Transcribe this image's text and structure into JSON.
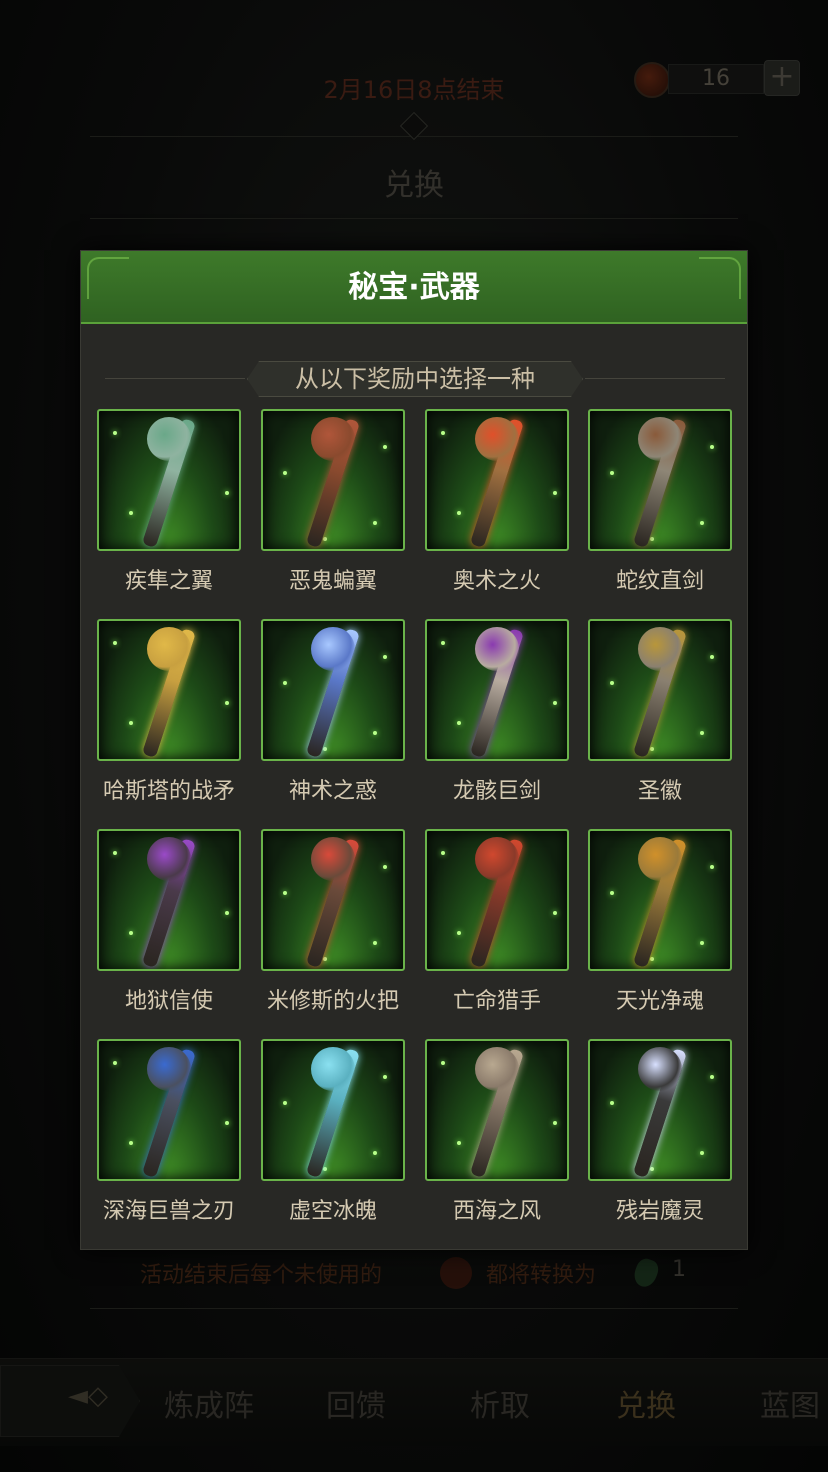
{
  "background": {
    "deadline": "2月16日8点结束",
    "currency_amount": "16",
    "plus_label": "+",
    "title": "兑换",
    "footer_text": "活动结束后每个未使用的",
    "footer_text2": "都将转换为",
    "footer_count": "1"
  },
  "bottom_nav": {
    "tabs": [
      "炼成阵",
      "回馈",
      "析取",
      "兑换",
      "蓝图"
    ],
    "active": "兑换"
  },
  "modal": {
    "title": "秘宝·武器",
    "subtitle": "从以下奖励中选择一种",
    "items": [
      {
        "name": "疾隼之翼",
        "color": "#8fb3a0",
        "accent": "#6aa889"
      },
      {
        "name": "恶鬼蝙翼",
        "color": "#8a4a2e",
        "accent": "#b0563a"
      },
      {
        "name": "奥术之火",
        "color": "#a07040",
        "accent": "#e0502a"
      },
      {
        "name": "蛇纹直剑",
        "color": "#8e8676",
        "accent": "#8a5a3a"
      },
      {
        "name": "哈斯塔的战矛",
        "color": "#c8a040",
        "accent": "#e0b848"
      },
      {
        "name": "神术之惑",
        "color": "#5a78c8",
        "accent": "#a8c8ff"
      },
      {
        "name": "龙骸巨剑",
        "color": "#b8aca0",
        "accent": "#8a3ab0"
      },
      {
        "name": "圣徽",
        "color": "#8a8070",
        "accent": "#b8963a"
      },
      {
        "name": "地狱信使",
        "color": "#4a3a4a",
        "accent": "#9a4ac8"
      },
      {
        "name": "米修斯的火把",
        "color": "#6a4a3a",
        "accent": "#d84a3a"
      },
      {
        "name": "亡命猎手",
        "color": "#8a3a2a",
        "accent": "#d0482e"
      },
      {
        "name": "天光净魂",
        "color": "#9a7a3a",
        "accent": "#d0902a"
      },
      {
        "name": "深海巨兽之刃",
        "color": "#4a5060",
        "accent": "#3a6ad0"
      },
      {
        "name": "虚空冰魄",
        "color": "#5ab0c0",
        "accent": "#8ae0f0"
      },
      {
        "name": "西海之风",
        "color": "#8a7a6a",
        "accent": "#b8a890"
      },
      {
        "name": "残岩魔灵",
        "color": "#3a3a3a",
        "accent": "#d8e0ff"
      }
    ]
  },
  "colors": {
    "header_green": "#3e7a2a",
    "tile_border": "#6ab34a",
    "panel_bg": "#282825"
  }
}
